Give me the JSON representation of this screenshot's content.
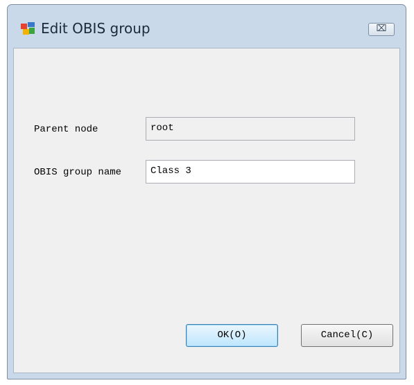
{
  "window": {
    "title": "Edit OBIS group",
    "close_label": "⌧"
  },
  "form": {
    "parent_node_label": "Parent node",
    "parent_node_value": "root",
    "group_name_label": "OBIS group name",
    "group_name_value": "Class 3"
  },
  "buttons": {
    "ok_label": "OK(O)",
    "cancel_label": "Cancel(C)"
  },
  "colors": {
    "title_bar": "#c9d9ea",
    "client_area": "#f0f0f0",
    "default_button_border": "#3c7fb1"
  }
}
